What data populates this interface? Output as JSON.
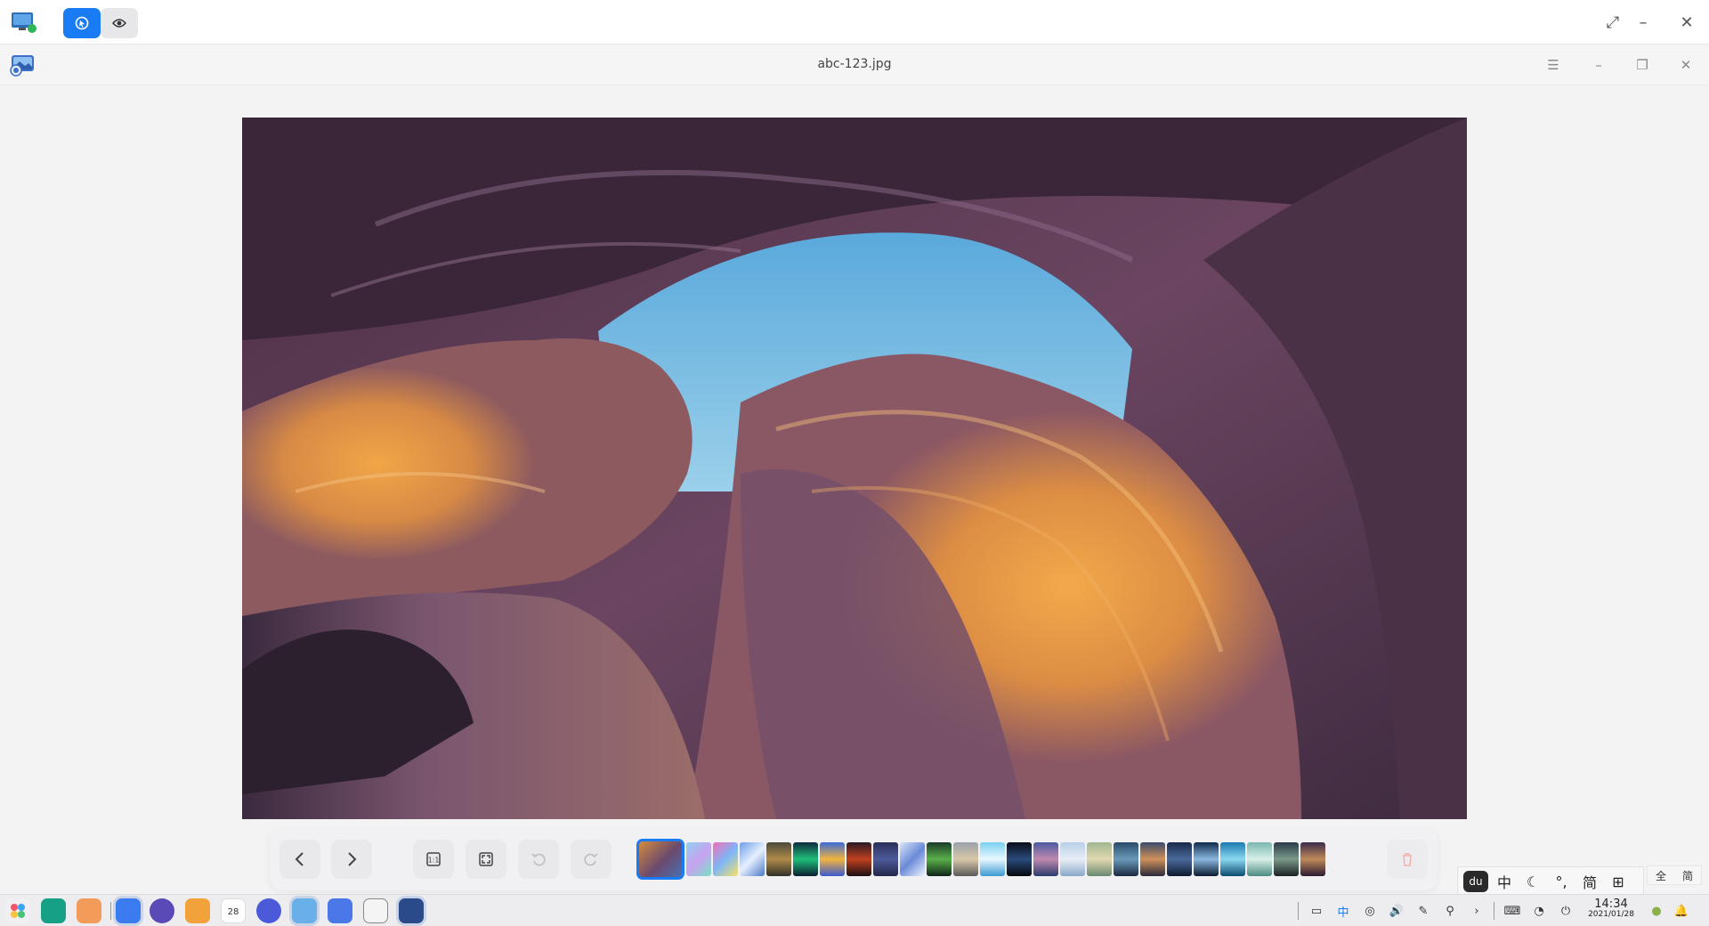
{
  "remote_bar": {
    "tabs": [
      {
        "icon": "remote-control-icon",
        "active": true
      },
      {
        "icon": "view-eye-icon",
        "active": false
      }
    ],
    "controls": [
      "expand-icon",
      "minimize-icon",
      "close-icon"
    ]
  },
  "viewer": {
    "title": "abc-123.jpg",
    "controls": [
      "menu-icon",
      "minimize-icon",
      "maximize-icon",
      "close-icon"
    ],
    "toolbar": {
      "buttons": [
        "previous-icon",
        "next-icon",
        "original-size-icon",
        "fit-window-icon",
        "rotate-left-icon",
        "rotate-right-icon"
      ],
      "thumbnail_count": 25,
      "delete": "trash-icon"
    }
  },
  "ime": {
    "logo": "du",
    "items": [
      "中",
      "☾",
      "°,",
      "简",
      "⊞"
    ],
    "extra": [
      "全",
      "简"
    ]
  },
  "dock": {
    "clock_time": "14:34",
    "clock_date": "2021/01/28",
    "calendar_day": "28"
  },
  "colors": {
    "accent": "#1a7cf5",
    "rock_orange": "#d98c3f",
    "rock_purple": "#5a3b55",
    "sky": "#6bb6dd"
  }
}
